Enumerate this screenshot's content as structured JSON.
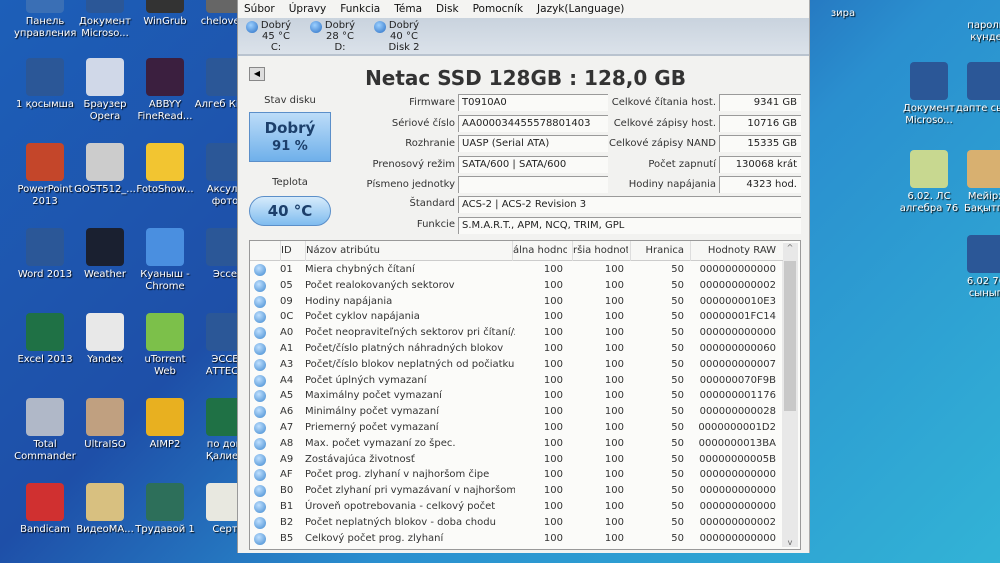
{
  "desktop": {
    "left_icons": [
      {
        "label": "Панель управления",
        "color": "#3a6fb5"
      },
      {
        "label": "Документ Microso...",
        "color": "#2b5797"
      },
      {
        "label": "WinGrub",
        "color": "#333"
      },
      {
        "label": "chelove...",
        "color": "#666"
      },
      {
        "label": "1 қосымша",
        "color": "#2b5797"
      },
      {
        "label": "Браузер Opera",
        "color": "#d0d8e8"
      },
      {
        "label": "ABBYY FineRead...",
        "color": "#3b1f3f"
      },
      {
        "label": "Алгеб КМЖ",
        "color": "#2b5797"
      },
      {
        "label": "PowerPoint 2013",
        "color": "#c4462a"
      },
      {
        "label": "GOST512_...",
        "color": "#ccc"
      },
      {
        "label": "FotoShow...",
        "color": "#f2c531"
      },
      {
        "label": "Аксулт фото",
        "color": "#2b5797"
      },
      {
        "label": "Word 2013",
        "color": "#2b5797"
      },
      {
        "label": "Weather",
        "color": "#1a2030"
      },
      {
        "label": "Куаныш - Chrome",
        "color": "#4a8fe0"
      },
      {
        "label": "Эссе",
        "color": "#2b5797"
      },
      {
        "label": "Excel 2013",
        "color": "#1f7145"
      },
      {
        "label": "Yandex",
        "color": "#e8e8e8"
      },
      {
        "label": "uTorrent Web",
        "color": "#7cc04a"
      },
      {
        "label": "ЭССЕ АТТЕСТ",
        "color": "#2b5797"
      },
      {
        "label": "Total Commander",
        "color": "#b0b8c8"
      },
      {
        "label": "UltraISO",
        "color": "#c0a080"
      },
      {
        "label": "AIMP2",
        "color": "#e8b020"
      },
      {
        "label": "по дом Қалиев",
        "color": "#1f7145"
      },
      {
        "label": "Bandicam",
        "color": "#d03030"
      },
      {
        "label": "ВидеоМА...",
        "color": "#d8c080"
      },
      {
        "label": "Трудавой 1",
        "color": "#2d6f5a"
      },
      {
        "label": "Серт",
        "color": "#e8e8e0"
      }
    ],
    "right_icons": [
      {
        "label": "зира",
        "color": ""
      },
      {
        "label": "пароль күнде",
        "color": ""
      },
      {
        "label": "Документ Microso...",
        "color": "#2b5797"
      },
      {
        "label": "дапте сырт",
        "color": "#2b5797"
      },
      {
        "label": "6.02. ЛС алгебра 76",
        "color": "#c8d890"
      },
      {
        "label": "Мейірх Бақытгү",
        "color": "#d8b070"
      },
      {
        "label": "6.02 76 сынып",
        "color": "#2b5797"
      }
    ]
  },
  "menu": [
    "Súbor",
    "Úpravy",
    "Funkcia",
    "Téma",
    "Disk",
    "Pomocník",
    "Jazyk(Language)"
  ],
  "disks": [
    {
      "status": "Dobrý",
      "temp": "45 °C",
      "name": "C:"
    },
    {
      "status": "Dobrý",
      "temp": "28 °C",
      "name": "D:"
    },
    {
      "status": "Dobrý",
      "temp": "40 °C",
      "name": "Disk 2"
    }
  ],
  "title": "Netac SSD 128GB : 128,0 GB",
  "health": {
    "label": "Stav disku",
    "status": "Dobrý",
    "percent": "91 %",
    "temp_label": "Teplota",
    "temp": "40 °C"
  },
  "info_left": [
    {
      "label": "Firmware",
      "value": "T0910A0"
    },
    {
      "label": "Sériové číslo",
      "value": "AA000034455578801403"
    },
    {
      "label": "Rozhranie",
      "value": "UASP (Serial ATA)"
    },
    {
      "label": "Prenosový režim",
      "value": "SATA/600 | SATA/600"
    },
    {
      "label": "Písmeno jednotky",
      "value": ""
    }
  ],
  "info_right": [
    {
      "label": "Celkové čítania host.",
      "value": "9341 GB"
    },
    {
      "label": "Celkové zápisy host.",
      "value": "10716 GB"
    },
    {
      "label": "Celkové zápisy NAND",
      "value": "15335 GB"
    },
    {
      "label": "Počet zapnutí",
      "value": "130068 krát"
    },
    {
      "label": "Hodiny napájania",
      "value": "4323 hod."
    }
  ],
  "standard": {
    "label": "Štandard",
    "value": "ACS-2 | ACS-2 Revision 3"
  },
  "features": {
    "label": "Funkcie",
    "value": "S.M.A.R.T., APM, NCQ, TRIM, GPL"
  },
  "table": {
    "headers": [
      "ID",
      "Názov atribútu",
      "álna hodnota",
      "ršia hodnota",
      "Hranica",
      "Hodnoty RAW"
    ],
    "rows": [
      [
        "01",
        "Miera chybných čítaní",
        "100",
        "100",
        "50",
        "000000000000"
      ],
      [
        "05",
        "Počet realokovaných sektorov",
        "100",
        "100",
        "50",
        "000000000002"
      ],
      [
        "09",
        "Hodiny napájania",
        "100",
        "100",
        "50",
        "0000000010E3"
      ],
      [
        "0C",
        "Počet cyklov napájania",
        "100",
        "100",
        "50",
        "00000001FC14"
      ],
      [
        "A0",
        "Počet neopraviteľných sektorov pri čítaní/zá...",
        "100",
        "100",
        "50",
        "000000000000"
      ],
      [
        "A1",
        "Počet/číslo platných náhradných blokov",
        "100",
        "100",
        "50",
        "000000000060"
      ],
      [
        "A3",
        "Počet/číslo blokov neplatných od počiatku",
        "100",
        "100",
        "50",
        "000000000007"
      ],
      [
        "A4",
        "Počet úplných vymazaní",
        "100",
        "100",
        "50",
        "000000070F9B"
      ],
      [
        "A5",
        "Maximálny počet vymazaní",
        "100",
        "100",
        "50",
        "000000001176"
      ],
      [
        "A6",
        "Minimálny počet vymazaní",
        "100",
        "100",
        "50",
        "000000000028"
      ],
      [
        "A7",
        "Priemerný počet vymazaní",
        "100",
        "100",
        "50",
        "0000000001D2"
      ],
      [
        "A8",
        "Max. počet vymazaní zo špec.",
        "100",
        "100",
        "50",
        "0000000013BA"
      ],
      [
        "A9",
        "Zostávajúca životnosť",
        "100",
        "100",
        "50",
        "00000000005B"
      ],
      [
        "AF",
        "Počet prog. zlyhaní v najhoršom čipe",
        "100",
        "100",
        "50",
        "000000000000"
      ],
      [
        "B0",
        "Počet zlyhaní pri vymazávaní v najhoršom č...",
        "100",
        "100",
        "50",
        "000000000000"
      ],
      [
        "B1",
        "Úroveň opotrebovania - celkový počet",
        "100",
        "100",
        "50",
        "000000000000"
      ],
      [
        "B2",
        "Počet neplatných blokov - doba chodu",
        "100",
        "100",
        "50",
        "000000000002"
      ],
      [
        "B5",
        "Celkový počet prog. zlyhaní",
        "100",
        "100",
        "50",
        "000000000000"
      ]
    ]
  }
}
